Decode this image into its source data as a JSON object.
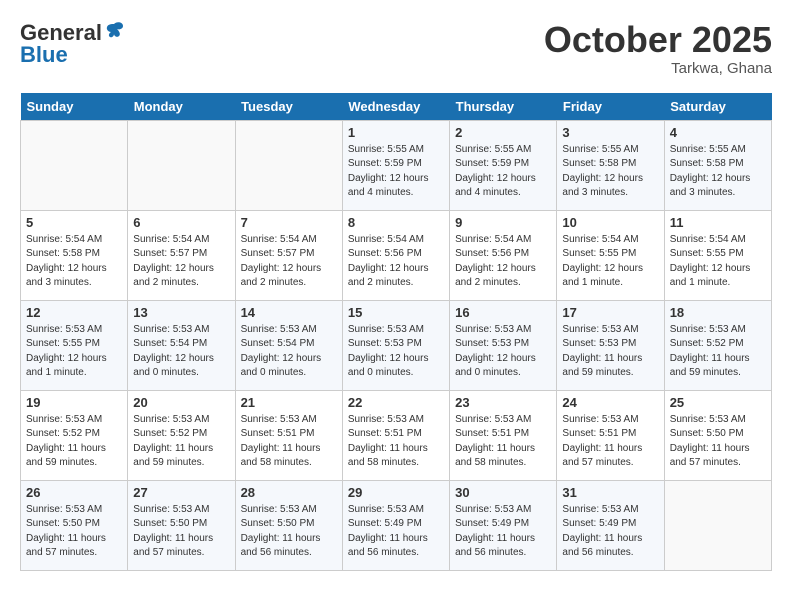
{
  "header": {
    "logo_general": "General",
    "logo_blue": "Blue",
    "month": "October 2025",
    "location": "Tarkwa, Ghana"
  },
  "weekdays": [
    "Sunday",
    "Monday",
    "Tuesday",
    "Wednesday",
    "Thursday",
    "Friday",
    "Saturday"
  ],
  "weeks": [
    [
      {
        "day": "",
        "sunrise": "",
        "sunset": "",
        "daylight": ""
      },
      {
        "day": "",
        "sunrise": "",
        "sunset": "",
        "daylight": ""
      },
      {
        "day": "",
        "sunrise": "",
        "sunset": "",
        "daylight": ""
      },
      {
        "day": "1",
        "sunrise": "Sunrise: 5:55 AM",
        "sunset": "Sunset: 5:59 PM",
        "daylight": "Daylight: 12 hours and 4 minutes."
      },
      {
        "day": "2",
        "sunrise": "Sunrise: 5:55 AM",
        "sunset": "Sunset: 5:59 PM",
        "daylight": "Daylight: 12 hours and 4 minutes."
      },
      {
        "day": "3",
        "sunrise": "Sunrise: 5:55 AM",
        "sunset": "Sunset: 5:58 PM",
        "daylight": "Daylight: 12 hours and 3 minutes."
      },
      {
        "day": "4",
        "sunrise": "Sunrise: 5:55 AM",
        "sunset": "Sunset: 5:58 PM",
        "daylight": "Daylight: 12 hours and 3 minutes."
      }
    ],
    [
      {
        "day": "5",
        "sunrise": "Sunrise: 5:54 AM",
        "sunset": "Sunset: 5:58 PM",
        "daylight": "Daylight: 12 hours and 3 minutes."
      },
      {
        "day": "6",
        "sunrise": "Sunrise: 5:54 AM",
        "sunset": "Sunset: 5:57 PM",
        "daylight": "Daylight: 12 hours and 2 minutes."
      },
      {
        "day": "7",
        "sunrise": "Sunrise: 5:54 AM",
        "sunset": "Sunset: 5:57 PM",
        "daylight": "Daylight: 12 hours and 2 minutes."
      },
      {
        "day": "8",
        "sunrise": "Sunrise: 5:54 AM",
        "sunset": "Sunset: 5:56 PM",
        "daylight": "Daylight: 12 hours and 2 minutes."
      },
      {
        "day": "9",
        "sunrise": "Sunrise: 5:54 AM",
        "sunset": "Sunset: 5:56 PM",
        "daylight": "Daylight: 12 hours and 2 minutes."
      },
      {
        "day": "10",
        "sunrise": "Sunrise: 5:54 AM",
        "sunset": "Sunset: 5:55 PM",
        "daylight": "Daylight: 12 hours and 1 minute."
      },
      {
        "day": "11",
        "sunrise": "Sunrise: 5:54 AM",
        "sunset": "Sunset: 5:55 PM",
        "daylight": "Daylight: 12 hours and 1 minute."
      }
    ],
    [
      {
        "day": "12",
        "sunrise": "Sunrise: 5:53 AM",
        "sunset": "Sunset: 5:55 PM",
        "daylight": "Daylight: 12 hours and 1 minute."
      },
      {
        "day": "13",
        "sunrise": "Sunrise: 5:53 AM",
        "sunset": "Sunset: 5:54 PM",
        "daylight": "Daylight: 12 hours and 0 minutes."
      },
      {
        "day": "14",
        "sunrise": "Sunrise: 5:53 AM",
        "sunset": "Sunset: 5:54 PM",
        "daylight": "Daylight: 12 hours and 0 minutes."
      },
      {
        "day": "15",
        "sunrise": "Sunrise: 5:53 AM",
        "sunset": "Sunset: 5:53 PM",
        "daylight": "Daylight: 12 hours and 0 minutes."
      },
      {
        "day": "16",
        "sunrise": "Sunrise: 5:53 AM",
        "sunset": "Sunset: 5:53 PM",
        "daylight": "Daylight: 12 hours and 0 minutes."
      },
      {
        "day": "17",
        "sunrise": "Sunrise: 5:53 AM",
        "sunset": "Sunset: 5:53 PM",
        "daylight": "Daylight: 11 hours and 59 minutes."
      },
      {
        "day": "18",
        "sunrise": "Sunrise: 5:53 AM",
        "sunset": "Sunset: 5:52 PM",
        "daylight": "Daylight: 11 hours and 59 minutes."
      }
    ],
    [
      {
        "day": "19",
        "sunrise": "Sunrise: 5:53 AM",
        "sunset": "Sunset: 5:52 PM",
        "daylight": "Daylight: 11 hours and 59 minutes."
      },
      {
        "day": "20",
        "sunrise": "Sunrise: 5:53 AM",
        "sunset": "Sunset: 5:52 PM",
        "daylight": "Daylight: 11 hours and 59 minutes."
      },
      {
        "day": "21",
        "sunrise": "Sunrise: 5:53 AM",
        "sunset": "Sunset: 5:51 PM",
        "daylight": "Daylight: 11 hours and 58 minutes."
      },
      {
        "day": "22",
        "sunrise": "Sunrise: 5:53 AM",
        "sunset": "Sunset: 5:51 PM",
        "daylight": "Daylight: 11 hours and 58 minutes."
      },
      {
        "day": "23",
        "sunrise": "Sunrise: 5:53 AM",
        "sunset": "Sunset: 5:51 PM",
        "daylight": "Daylight: 11 hours and 58 minutes."
      },
      {
        "day": "24",
        "sunrise": "Sunrise: 5:53 AM",
        "sunset": "Sunset: 5:51 PM",
        "daylight": "Daylight: 11 hours and 57 minutes."
      },
      {
        "day": "25",
        "sunrise": "Sunrise: 5:53 AM",
        "sunset": "Sunset: 5:50 PM",
        "daylight": "Daylight: 11 hours and 57 minutes."
      }
    ],
    [
      {
        "day": "26",
        "sunrise": "Sunrise: 5:53 AM",
        "sunset": "Sunset: 5:50 PM",
        "daylight": "Daylight: 11 hours and 57 minutes."
      },
      {
        "day": "27",
        "sunrise": "Sunrise: 5:53 AM",
        "sunset": "Sunset: 5:50 PM",
        "daylight": "Daylight: 11 hours and 57 minutes."
      },
      {
        "day": "28",
        "sunrise": "Sunrise: 5:53 AM",
        "sunset": "Sunset: 5:50 PM",
        "daylight": "Daylight: 11 hours and 56 minutes."
      },
      {
        "day": "29",
        "sunrise": "Sunrise: 5:53 AM",
        "sunset": "Sunset: 5:49 PM",
        "daylight": "Daylight: 11 hours and 56 minutes."
      },
      {
        "day": "30",
        "sunrise": "Sunrise: 5:53 AM",
        "sunset": "Sunset: 5:49 PM",
        "daylight": "Daylight: 11 hours and 56 minutes."
      },
      {
        "day": "31",
        "sunrise": "Sunrise: 5:53 AM",
        "sunset": "Sunset: 5:49 PM",
        "daylight": "Daylight: 11 hours and 56 minutes."
      },
      {
        "day": "",
        "sunrise": "",
        "sunset": "",
        "daylight": ""
      }
    ]
  ]
}
